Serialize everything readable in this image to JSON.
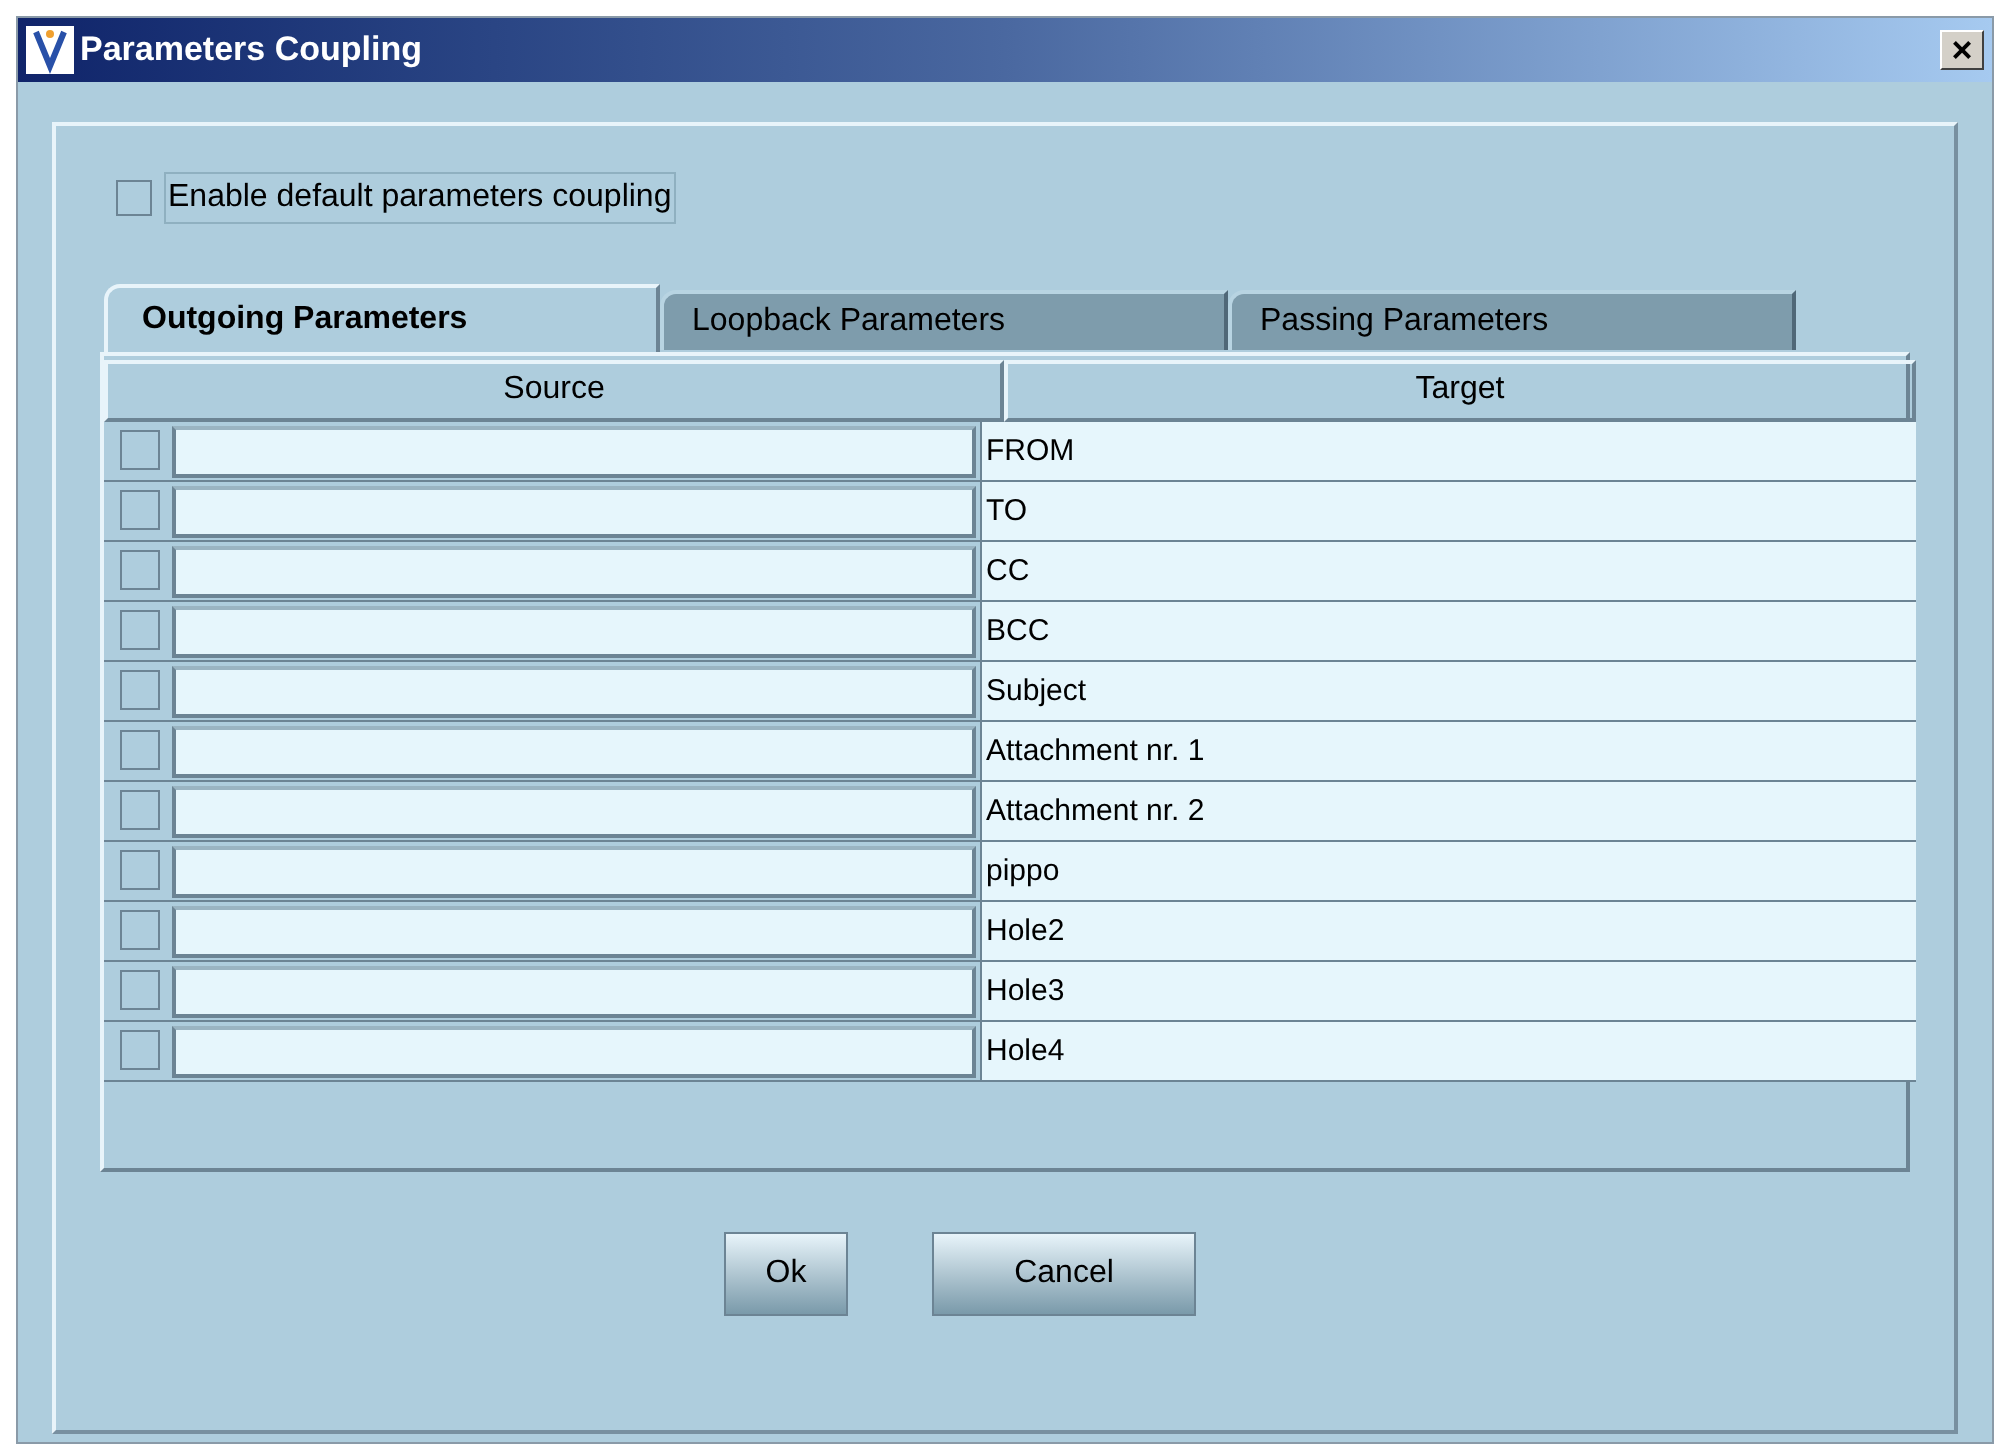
{
  "window": {
    "title": "Parameters Coupling",
    "close": "×"
  },
  "enable_default_coupling": {
    "label": "Enable default parameters coupling",
    "checked": false
  },
  "tabs": [
    {
      "label": "Outgoing Parameters",
      "selected": true
    },
    {
      "label": "Loopback Parameters",
      "selected": false
    },
    {
      "label": "Passing Parameters",
      "selected": false
    }
  ],
  "table": {
    "columns": [
      "Source",
      "Target"
    ],
    "rows": [
      {
        "checked": false,
        "target": "FROM"
      },
      {
        "checked": false,
        "target": "TO"
      },
      {
        "checked": false,
        "target": "CC"
      },
      {
        "checked": false,
        "target": "BCC"
      },
      {
        "checked": false,
        "target": "Subject"
      },
      {
        "checked": false,
        "target": "Attachment nr. 1"
      },
      {
        "checked": false,
        "target": "Attachment nr. 2"
      },
      {
        "checked": false,
        "target": "pippo"
      },
      {
        "checked": false,
        "target": "Hole2"
      },
      {
        "checked": false,
        "target": "Hole3"
      },
      {
        "checked": false,
        "target": "Hole4"
      }
    ]
  },
  "buttons": [
    "Ok",
    "Cancel"
  ]
}
